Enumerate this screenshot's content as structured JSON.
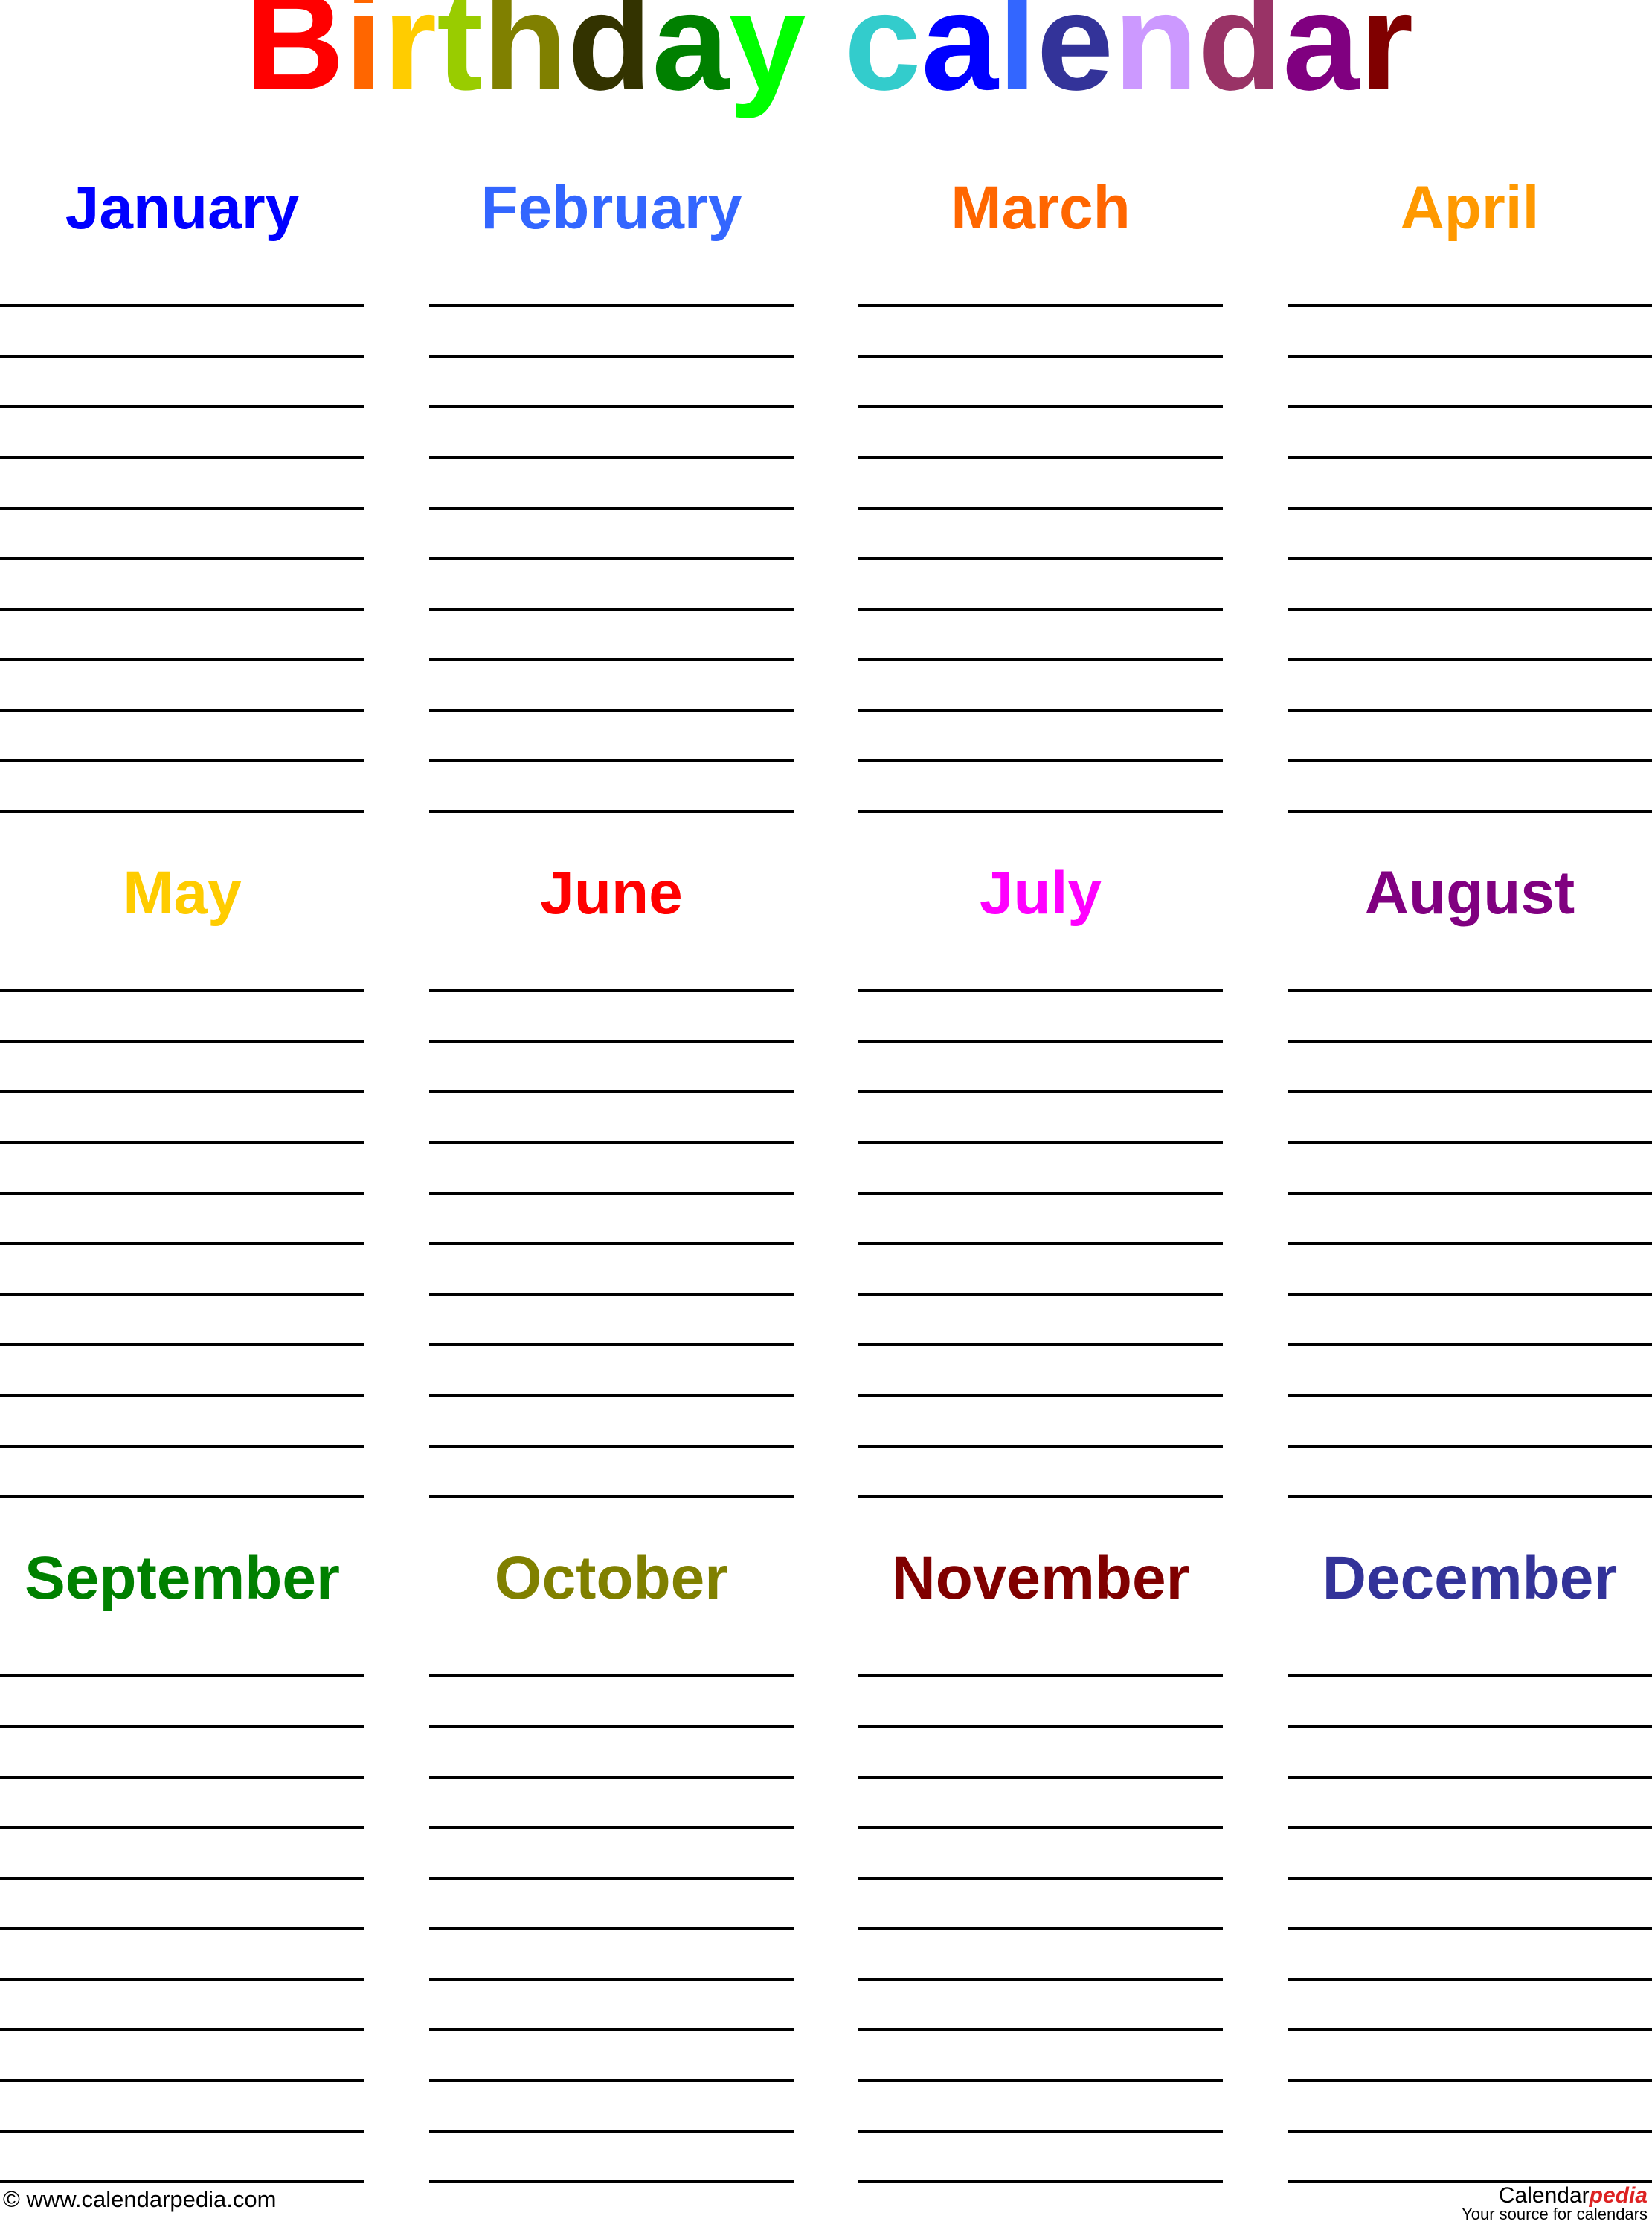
{
  "title": {
    "text": "Birthday calendar",
    "letters": [
      {
        "char": "B",
        "color": "#FF0000"
      },
      {
        "char": "i",
        "color": "#FF6600"
      },
      {
        "char": "r",
        "color": "#FFCC00"
      },
      {
        "char": "t",
        "color": "#99CC00"
      },
      {
        "char": "h",
        "color": "#808000"
      },
      {
        "char": "d",
        "color": "#333300"
      },
      {
        "char": "a",
        "color": "#008000"
      },
      {
        "char": "y",
        "color": "#00FF00"
      },
      {
        "char": " ",
        "color": "#000000"
      },
      {
        "char": "c",
        "color": "#33CCCC"
      },
      {
        "char": "a",
        "color": "#0000FF"
      },
      {
        "char": "l",
        "color": "#3366FF"
      },
      {
        "char": "e",
        "color": "#333399"
      },
      {
        "char": "n",
        "color": "#CC99FF"
      },
      {
        "char": "d",
        "color": "#993366"
      },
      {
        "char": "a",
        "color": "#800080"
      },
      {
        "char": "r",
        "color": "#800000"
      }
    ]
  },
  "lines_per_month": 11,
  "months": [
    {
      "name": "January",
      "color": "#0000FF"
    },
    {
      "name": "February",
      "color": "#3366FF"
    },
    {
      "name": "March",
      "color": "#FF6600"
    },
    {
      "name": "April",
      "color": "#FF9900"
    },
    {
      "name": "May",
      "color": "#FFCC00"
    },
    {
      "name": "June",
      "color": "#FF0000"
    },
    {
      "name": "July",
      "color": "#FF00FF"
    },
    {
      "name": "August",
      "color": "#800080"
    },
    {
      "name": "September",
      "color": "#008000"
    },
    {
      "name": "October",
      "color": "#808000"
    },
    {
      "name": "November",
      "color": "#800000"
    },
    {
      "name": "December",
      "color": "#333399"
    }
  ],
  "footer": {
    "copyright": "© www.calendarpedia.com",
    "brand_main": "Calendar",
    "brand_accent": "pedia",
    "brand_accent_color": "#DD2222",
    "tagline": "Your source for calendars"
  }
}
